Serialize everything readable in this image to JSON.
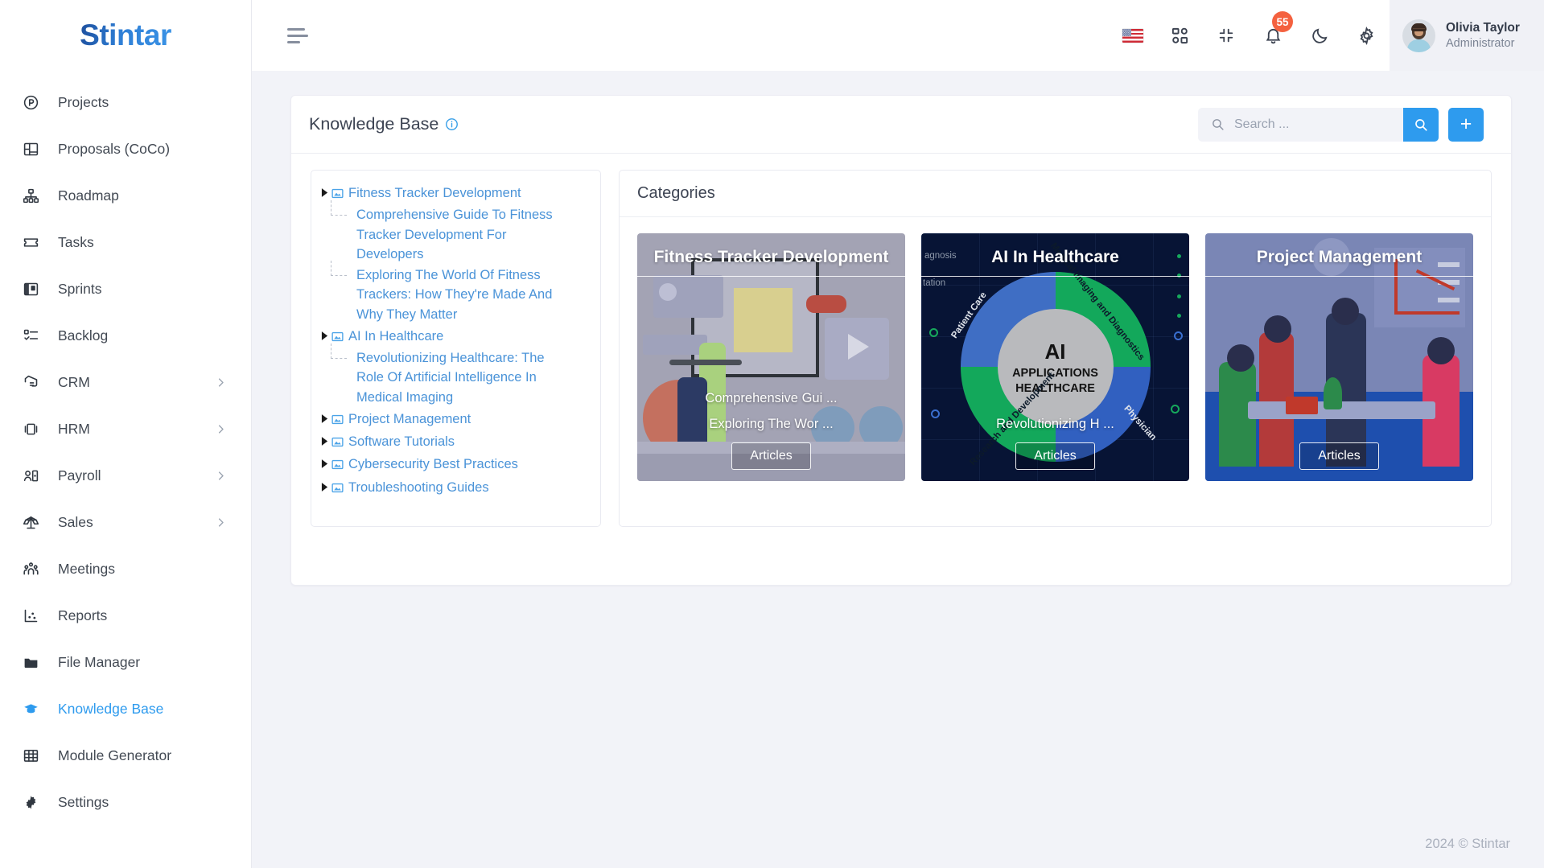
{
  "brand": {
    "lead": "S",
    "rest": "tintar",
    "full": "Stintar"
  },
  "sidebar": {
    "items": [
      {
        "label": "Projects",
        "icon": "circle-p-icon",
        "caret": false,
        "active": false
      },
      {
        "label": "Proposals (CoCo)",
        "icon": "layout-panels-icon",
        "caret": false,
        "active": false
      },
      {
        "label": "Roadmap",
        "icon": "sitemap-icon",
        "caret": false,
        "active": false
      },
      {
        "label": "Tasks",
        "icon": "ticket-icon",
        "caret": false,
        "active": false
      },
      {
        "label": "Sprints",
        "icon": "board-columns-icon",
        "caret": false,
        "active": false
      },
      {
        "label": "Backlog",
        "icon": "checklist-icon",
        "caret": false,
        "active": false
      },
      {
        "label": "CRM",
        "icon": "handshake-icon",
        "caret": true,
        "active": false
      },
      {
        "label": "HRM",
        "icon": "id-badge-icon",
        "caret": true,
        "active": false
      },
      {
        "label": "Payroll",
        "icon": "user-card-icon",
        "caret": true,
        "active": false
      },
      {
        "label": "Sales",
        "icon": "scales-icon",
        "caret": true,
        "active": false
      },
      {
        "label": "Meetings",
        "icon": "people-group-icon",
        "caret": false,
        "active": false
      },
      {
        "label": "Reports",
        "icon": "scatter-chart-icon",
        "caret": false,
        "active": false
      },
      {
        "label": "File Manager",
        "icon": "folder-icon",
        "caret": false,
        "active": false
      },
      {
        "label": "Knowledge Base",
        "icon": "graduation-cap-icon",
        "caret": false,
        "active": true
      },
      {
        "label": "Module Generator",
        "icon": "table-grid-icon",
        "caret": false,
        "active": false
      },
      {
        "label": "Settings",
        "icon": "gear-icon",
        "caret": false,
        "active": false
      }
    ]
  },
  "topbar": {
    "menu_toggle": "hamburger-icon",
    "icons": [
      {
        "name": "language-flag-us",
        "label": "US"
      },
      {
        "name": "apps-grid-icon",
        "label": "Apps"
      },
      {
        "name": "compress-icon",
        "label": "Exit Fullscreen"
      },
      {
        "name": "bell-icon",
        "label": "Notifications",
        "badge": "55"
      },
      {
        "name": "moon-icon",
        "label": "Dark Mode"
      },
      {
        "name": "gear-icon",
        "label": "Settings"
      }
    ],
    "notification_count": "55",
    "profile": {
      "name": "Olivia Taylor",
      "role": "Administrator"
    }
  },
  "page": {
    "title": "Knowledge Base",
    "info_icon": "info-circle-icon",
    "search": {
      "placeholder": "Search ...",
      "value": "",
      "icon": "search-icon"
    },
    "search_button_icon": "search-icon",
    "add_button_label": "+"
  },
  "tree": {
    "nodes": [
      {
        "label": "Fitness Tracker Development",
        "icon": "image-icon",
        "expandable": true,
        "children": [
          "Comprehensive Guide To Fitness Tracker Development For Developers",
          "Exploring The World Of Fitness Trackers: How They're Made And Why They Matter"
        ]
      },
      {
        "label": "AI In Healthcare",
        "icon": "image-icon",
        "expandable": true,
        "children": [
          "Revolutionizing Healthcare: The Role Of Artificial Intelligence In Medical Imaging"
        ]
      },
      {
        "label": "Project Management",
        "icon": "image-icon",
        "expandable": true,
        "children": []
      },
      {
        "label": "Software Tutorials",
        "icon": "image-icon",
        "expandable": true,
        "children": []
      },
      {
        "label": "Cybersecurity Best Practices",
        "icon": "image-icon",
        "expandable": true,
        "children": []
      },
      {
        "label": "Troubleshooting Guides",
        "icon": "image-icon",
        "expandable": true,
        "children": []
      }
    ]
  },
  "categories": {
    "heading": "Categories",
    "tiles": [
      {
        "title": "Fitness Tracker Development",
        "links": [
          "Comprehensive Gui ...",
          "Exploring The Wor ..."
        ],
        "button": "Articles",
        "theme": "fitness-illustration"
      },
      {
        "title": "AI In Healthcare",
        "links": [
          "Revolutionizing H ..."
        ],
        "button": "Articles",
        "theme": "ai-donut-diagram",
        "diagram": {
          "center": [
            "AI",
            "APPLICATIONS",
            "HEALTHCARE"
          ],
          "segments": [
            {
              "label": "Patient Care",
              "color": "#3160c0"
            },
            {
              "label": "Medical Imaging and Diagnostics",
              "color": "#13a85b"
            },
            {
              "label": "Physician",
              "color": "#3f6ec4"
            },
            {
              "label": "Research and Development",
              "color": "#13a85b"
            }
          ],
          "edge_labels": [
            "agnosis",
            "tation"
          ]
        }
      },
      {
        "title": "Project Management",
        "links": [],
        "button": "Articles",
        "theme": "meeting-illustration"
      }
    ]
  },
  "footer": {
    "copyright": "2024 © Stintar"
  },
  "colors": {
    "accent": "#2e9bee",
    "link": "#4a93d8",
    "badge": "#f4613f",
    "page_bg": "#f2f3f8",
    "panel_bg": "#ffffff"
  }
}
